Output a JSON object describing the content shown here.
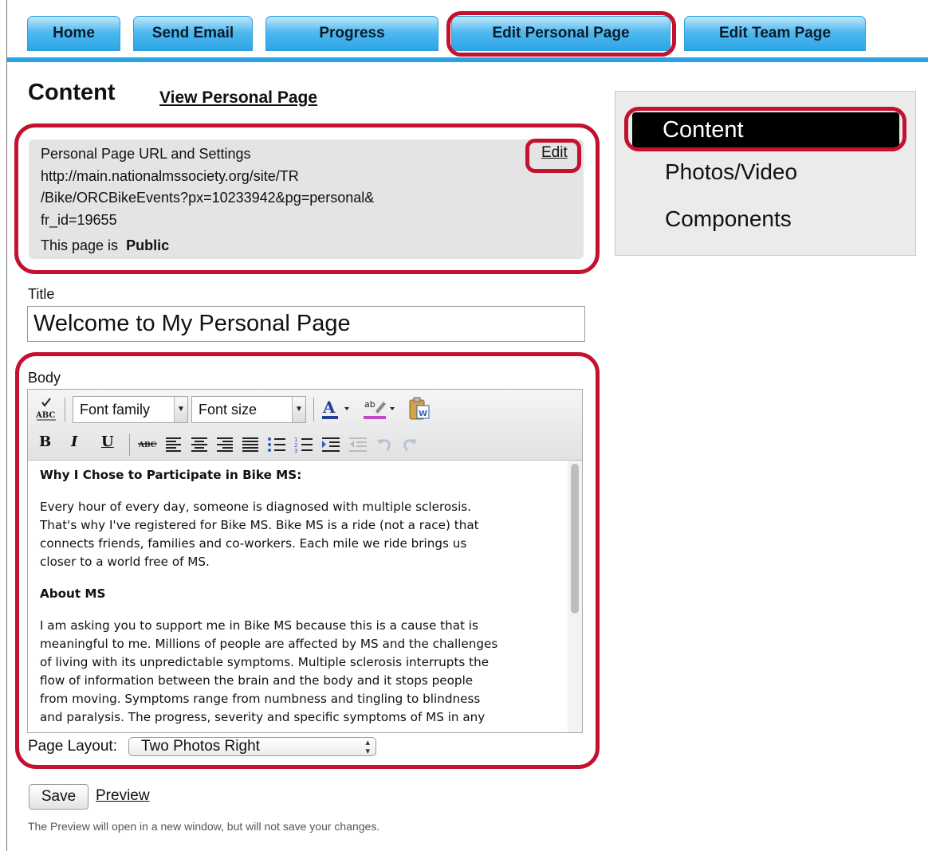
{
  "nav": {
    "tabs": [
      {
        "label": "Home"
      },
      {
        "label": "Send Email"
      },
      {
        "label": "Progress"
      },
      {
        "label": "Edit Personal Page",
        "selected": true
      },
      {
        "label": "Edit Team Page"
      }
    ]
  },
  "header": {
    "title": "Content",
    "view_link": "View Personal Page"
  },
  "settings": {
    "heading": "Personal Page URL and Settings",
    "edit_link": "Edit",
    "url_lines": [
      "http://main.nationalmssociety.org/site/TR",
      "/Bike/ORCBikeEvents?px=10233942&pg=personal&",
      "fr_id=19655"
    ],
    "visibility_label": "This page is",
    "visibility_value": "Public"
  },
  "sidebar": {
    "items": [
      {
        "label": "Content",
        "active": true
      },
      {
        "label": "Photos/Video"
      },
      {
        "label": "Components"
      }
    ]
  },
  "title_field": {
    "label": "Title",
    "value": "Welcome to My Personal Page"
  },
  "body_field": {
    "label": "Body",
    "font_family_placeholder": "Font family",
    "font_size_placeholder": "Font size",
    "content": [
      {
        "type": "heading",
        "text": "Why I Chose to Participate in Bike MS:"
      },
      {
        "type": "paragraph",
        "lines": [
          "Every hour of every day, someone is diagnosed with multiple sclerosis.",
          "That's why I've registered for Bike MS. Bike MS is a ride (not a race) that",
          "connects friends, families and co-workers. Each mile we ride brings us",
          "closer to a world free of MS."
        ]
      },
      {
        "type": "heading",
        "text": "About MS"
      },
      {
        "type": "paragraph",
        "lines": [
          "I am asking you to support me in Bike MS because this is a cause that is",
          "meaningful to me.  Millions of people are affected by MS and the challenges",
          "of living with its unpredictable symptoms. Multiple sclerosis interrupts the",
          "flow of information between the brain and the body and it stops people",
          "from moving. Symptoms range from numbness and tingling to blindness",
          "and paralysis. The progress, severity and specific symptoms of MS in any"
        ]
      }
    ]
  },
  "layout_field": {
    "label": "Page Layout:",
    "selected": "Two Photos Right"
  },
  "actions": {
    "save_label": "Save",
    "preview_label": "Preview",
    "note": "The Preview will open in a new window, but will not save your changes."
  },
  "colors": {
    "nav_blue": "#2ea4e6",
    "highlight_red": "#c4112f",
    "panel_gray": "#e4e4e4",
    "active_menu_bg": "#000000"
  }
}
